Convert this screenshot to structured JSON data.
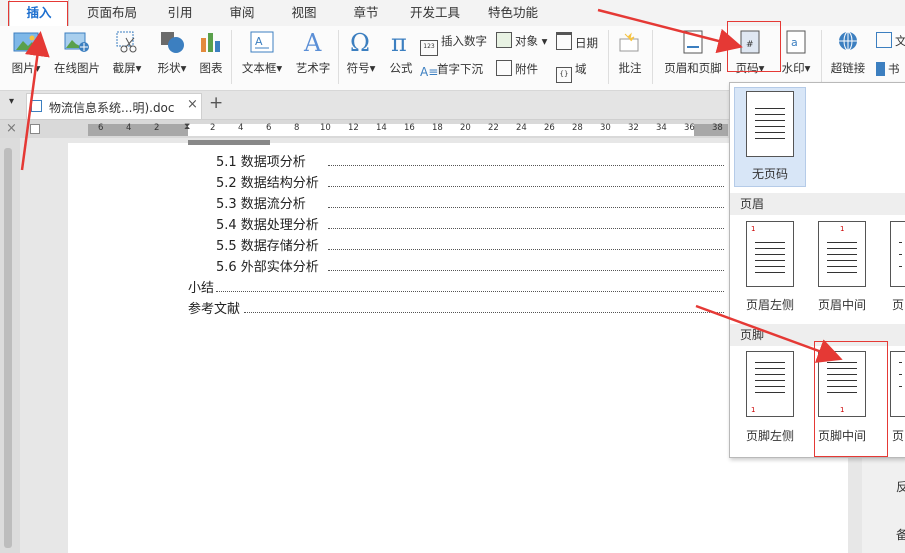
{
  "menu": {
    "tabs": [
      "插入",
      "页面布局",
      "引用",
      "审阅",
      "视图",
      "章节",
      "开发工具",
      "特色功能"
    ],
    "active_tab": "插入"
  },
  "ribbon": {
    "picture": "图片",
    "online_picture": "在线图片",
    "screenshot": "截屏",
    "shape": "形状",
    "chart": "图表",
    "textbox": "文本框",
    "wordart": "艺术字",
    "symbol": "符号",
    "formula": "公式",
    "insert_number": "插入数字",
    "object": "对象",
    "date": "日期",
    "drop_cap": "首字下沉",
    "attachment": "附件",
    "field": "域",
    "comment": "批注",
    "header_footer": "页眉和页脚",
    "page_number": "页码",
    "watermark": "水印",
    "hyperlink": "超链接",
    "text_short": "文",
    "bookmark_short": "书",
    "insert_number_icon_text": "123"
  },
  "tabbar": {
    "doc_title": "物流信息系统...明).doc",
    "add": "+"
  },
  "ruler": {
    "ticks": [
      "6",
      "4",
      "2",
      "2",
      "4",
      "6",
      "8",
      "10",
      "12",
      "14",
      "16",
      "18",
      "20",
      "22",
      "24",
      "26",
      "28",
      "30",
      "32",
      "34",
      "36",
      "38"
    ]
  },
  "document": {
    "toc": [
      {
        "text": "5.1 数据项分析"
      },
      {
        "text": "5.2 数据结构分析"
      },
      {
        "text": "5.3 数据流分析"
      },
      {
        "text": "5.4 数据处理分析"
      },
      {
        "text": "5.5 数据存储分析"
      },
      {
        "text": "5.6 外部实体分析"
      },
      {
        "text": "小结"
      },
      {
        "text": "参考文献"
      }
    ]
  },
  "dropdown": {
    "none_label": "无页码",
    "header_section": "页眉",
    "header_left": "页眉左侧",
    "header_center": "页眉中间",
    "header_right": "页",
    "footer_section": "页脚",
    "footer_left": "页脚左侧",
    "footer_center": "页脚中间",
    "footer_right": "页",
    "thumb_number": "1"
  },
  "rightpanel": {
    "item1": "反",
    "item2": "备"
  },
  "colors": {
    "accent": "#1d6fcf",
    "annotation_red": "#e53935"
  }
}
